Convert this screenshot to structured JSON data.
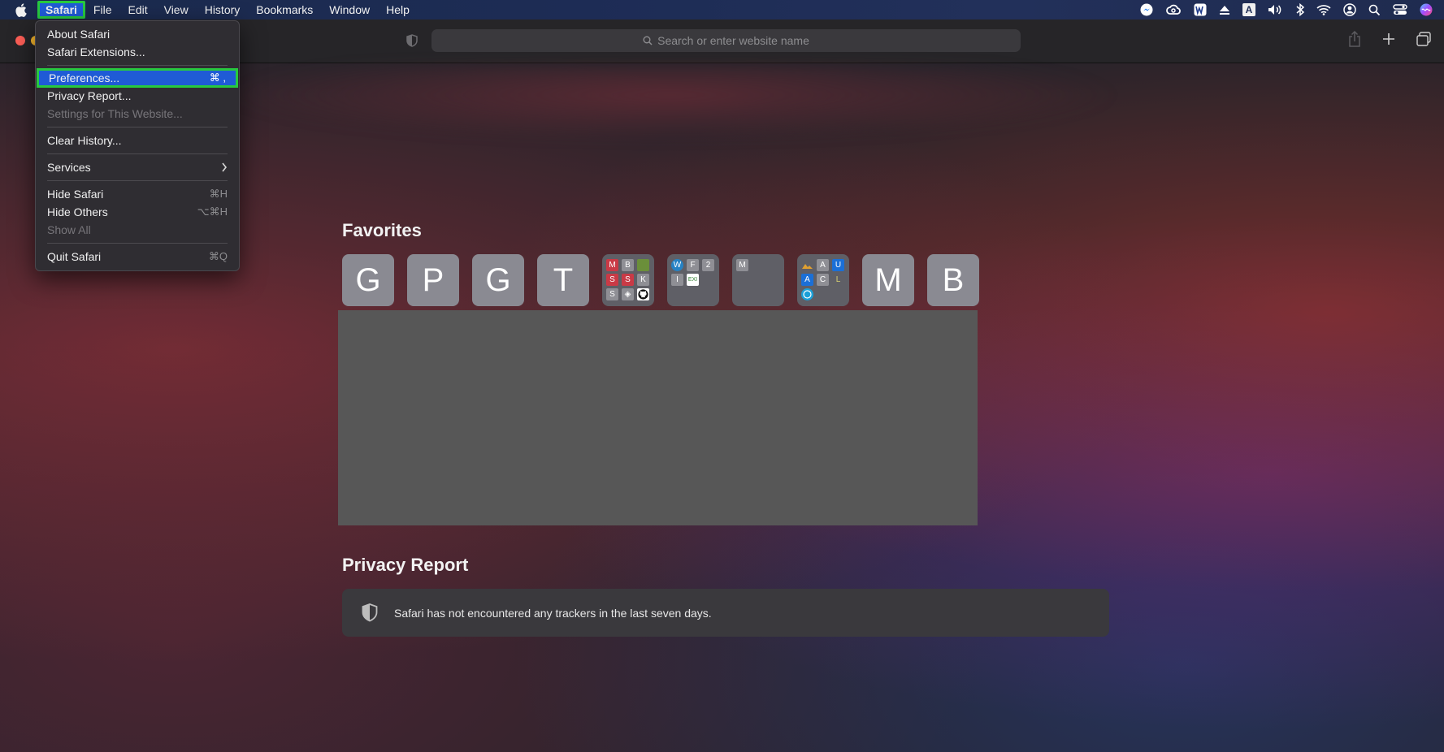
{
  "menubar": {
    "items": [
      "Safari",
      "File",
      "Edit",
      "View",
      "History",
      "Bookmarks",
      "Window",
      "Help"
    ]
  },
  "status_icons": [
    "messenger-icon",
    "creative-cloud-icon",
    "word-icon",
    "eject-icon",
    "input-source-icon",
    "volume-icon",
    "bluetooth-icon",
    "wifi-icon",
    "user-icon",
    "spotlight-icon",
    "control-center-icon",
    "siri-icon"
  ],
  "status_input_letter": "A",
  "toolbar": {
    "search_placeholder": "Search or enter website name"
  },
  "dropdown": {
    "about": "About Safari",
    "extensions": "Safari Extensions...",
    "preferences": "Preferences...",
    "preferences_shortcut": "⌘ ,",
    "privacy_report": "Privacy Report...",
    "settings_website": "Settings for This Website...",
    "clear_history": "Clear History...",
    "services": "Services",
    "hide_safari": "Hide Safari",
    "hide_safari_shortcut": "⌘H",
    "hide_others": "Hide Others",
    "hide_others_shortcut": "⌥⌘H",
    "show_all": "Show All",
    "quit": "Quit Safari",
    "quit_shortcut": "⌘Q"
  },
  "favorites": {
    "title": "Favorites",
    "tiles": [
      "G",
      "P",
      "G",
      "T",
      "",
      "",
      "",
      "",
      "M",
      "B"
    ],
    "folder1": [
      "M",
      "B",
      "S",
      "S",
      "K",
      "S"
    ],
    "folder2": [
      "F",
      "2",
      "I",
      "EXI"
    ],
    "folder3": [
      "M"
    ],
    "folder4": [
      "A",
      "U",
      "A",
      "C",
      "L"
    ]
  },
  "privacy": {
    "title": "Privacy Report",
    "message": "Safari has not encountered any trackers in the last seven days."
  },
  "colors": {
    "highlight": "#1f5bd6",
    "annotation": "#27c93f"
  }
}
